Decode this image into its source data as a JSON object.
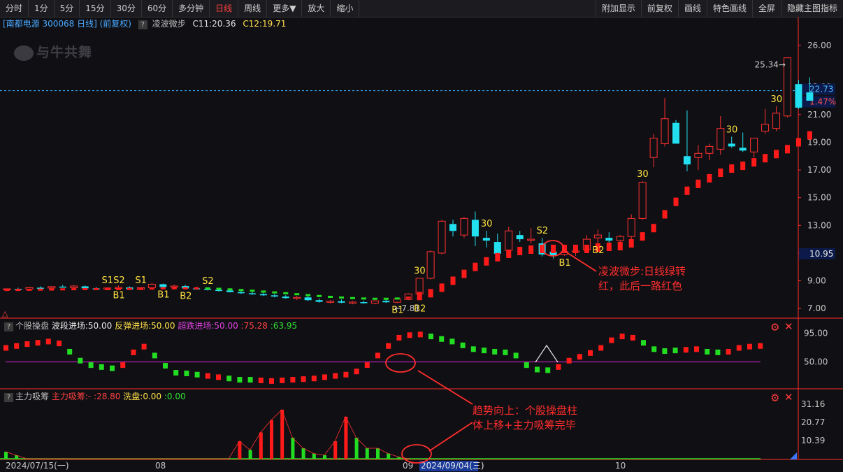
{
  "toolbar": {
    "left": [
      "分时",
      "1分",
      "5分",
      "15分",
      "30分",
      "60分",
      "多分钟",
      "日线",
      "周线",
      "更多▼",
      "放大",
      "缩小"
    ],
    "active_index": 7,
    "right": [
      "附加显示",
      "前复权",
      "画线",
      "特色画线",
      "全屏",
      "隐藏主图指标"
    ]
  },
  "infobar": {
    "stock": "[南都电源 300068 日线] (前复权)",
    "indicator": "凌波微步",
    "c1": "C11:20.36",
    "c2": "C12:19.71"
  },
  "logo": "与牛共舞",
  "panel2": {
    "name": "个股操盘",
    "s1": "波段进场:50.00",
    "s2": "反弹进场:50.00",
    "s3": "超跌进场:50.00",
    "s4": ":75.28",
    "s5": ":63.95",
    "yticks": [
      "95.00",
      "50.00"
    ]
  },
  "panel3": {
    "name": "主力吸筹",
    "s1": "主力吸筹:-",
    "s2": ":28.80",
    "s3": "洗盘:0.00",
    "s4": ":0.00",
    "yticks": [
      "31.16",
      "20.77",
      "10.39"
    ]
  },
  "colors": {
    "up": "#ff3030",
    "down": "#22e0f0",
    "ma": "#ff1a1a",
    "ma_green": "#22dd22",
    "signal": "#ffe040",
    "annot": "#ff2d2d",
    "axis": "#ff2d2d",
    "magenta": "#c020c0"
  },
  "chart_data": {
    "type": "candlestick",
    "ylim": [
      6.3,
      27.0
    ],
    "yticks": [
      "26.00",
      "23.00",
      "21.00",
      "19.00",
      "17.00",
      "15.00",
      "13.00",
      "11.00",
      "9.00",
      "7.00"
    ],
    "price_label": "22.73",
    "pct_label": "1.47%",
    "cross_label": "10.95",
    "high_label": "25.34",
    "low_label": "7.81",
    "x_labels": [
      "2024/07/15(一)",
      "08",
      "09",
      "2024/09/04(三)",
      "10"
    ],
    "candles": [
      [
        8.4,
        8.45,
        8.35,
        8.42
      ],
      [
        8.42,
        8.5,
        8.36,
        8.4
      ],
      [
        8.4,
        8.55,
        8.38,
        8.5
      ],
      [
        8.5,
        8.6,
        8.45,
        8.48
      ],
      [
        8.48,
        8.62,
        8.44,
        8.58
      ],
      [
        8.58,
        8.7,
        8.5,
        8.52
      ],
      [
        8.5,
        8.7,
        8.46,
        8.62
      ],
      [
        8.6,
        8.66,
        8.4,
        8.45
      ],
      [
        8.45,
        8.55,
        8.36,
        8.4
      ],
      [
        8.4,
        8.52,
        8.34,
        8.48
      ],
      [
        8.48,
        8.66,
        8.44,
        8.52
      ],
      [
        8.52,
        8.6,
        8.35,
        8.38
      ],
      [
        8.38,
        8.52,
        8.32,
        8.5
      ],
      [
        8.5,
        8.85,
        8.46,
        8.75
      ],
      [
        8.75,
        8.8,
        8.5,
        8.55
      ],
      [
        8.55,
        8.72,
        8.48,
        8.62
      ],
      [
        8.62,
        8.7,
        8.4,
        8.45
      ],
      [
        8.45,
        8.55,
        8.36,
        8.42
      ],
      [
        8.42,
        8.48,
        8.3,
        8.34
      ],
      [
        8.34,
        8.44,
        8.22,
        8.3
      ],
      [
        8.3,
        8.4,
        8.16,
        8.18
      ],
      [
        8.18,
        8.28,
        8.05,
        8.1
      ],
      [
        8.1,
        8.2,
        7.98,
        8.04
      ],
      [
        8.04,
        8.16,
        7.9,
        7.95
      ],
      [
        7.95,
        8.05,
        7.8,
        7.86
      ],
      [
        7.86,
        7.96,
        7.7,
        7.75
      ],
      [
        7.75,
        7.9,
        7.62,
        7.8
      ],
      [
        7.8,
        7.92,
        7.54,
        7.6
      ],
      [
        7.6,
        7.72,
        7.42,
        7.48
      ],
      [
        7.48,
        7.6,
        7.36,
        7.52
      ],
      [
        7.52,
        7.66,
        7.38,
        7.42
      ],
      [
        7.42,
        7.54,
        7.3,
        7.46
      ],
      [
        7.46,
        7.56,
        7.34,
        7.38
      ],
      [
        7.38,
        7.6,
        7.3,
        7.55
      ],
      [
        7.55,
        7.66,
        7.4,
        7.45
      ],
      [
        7.45,
        7.72,
        7.38,
        7.68
      ],
      [
        7.65,
        8.1,
        7.6,
        8.05
      ],
      [
        8.05,
        9.2,
        8.0,
        9.18
      ],
      [
        9.18,
        11.2,
        9.1,
        11.1
      ],
      [
        11.0,
        13.4,
        10.9,
        13.3
      ],
      [
        13.1,
        13.4,
        12.2,
        12.6
      ],
      [
        12.3,
        13.6,
        12.1,
        13.5
      ],
      [
        13.4,
        14.0,
        11.5,
        12.2
      ],
      [
        12.1,
        12.6,
        11.4,
        11.9
      ],
      [
        11.8,
        12.4,
        10.7,
        10.95
      ],
      [
        11.2,
        12.9,
        11.1,
        12.6
      ],
      [
        12.3,
        12.6,
        11.8,
        12.0
      ],
      [
        12.0,
        12.8,
        11.7,
        12.0
      ],
      [
        11.7,
        12.1,
        10.75,
        10.9
      ],
      [
        11.1,
        11.5,
        10.6,
        10.8
      ],
      [
        10.9,
        11.2,
        10.8,
        11.1
      ],
      [
        11.1,
        11.3,
        10.8,
        11.15
      ],
      [
        11.25,
        12.3,
        11.2,
        12.0
      ],
      [
        12.1,
        12.7,
        11.7,
        12.3
      ],
      [
        12.1,
        12.5,
        11.6,
        11.9
      ],
      [
        11.9,
        12.3,
        11.6,
        12.2
      ],
      [
        12.2,
        13.8,
        11.9,
        13.5
      ],
      [
        13.5,
        16.2,
        13.4,
        16.1
      ],
      [
        17.9,
        19.6,
        17.2,
        19.3
      ],
      [
        18.9,
        22.2,
        18.7,
        20.7
      ],
      [
        20.4,
        20.6,
        18.9,
        18.9
      ],
      [
        18.0,
        21.3,
        16.9,
        17.4
      ],
      [
        17.9,
        18.8,
        17.0,
        18.2
      ],
      [
        18.2,
        18.9,
        17.7,
        18.7
      ],
      [
        18.5,
        20.9,
        18.1,
        20.0
      ],
      [
        18.9,
        19.4,
        18.6,
        18.7
      ],
      [
        18.6,
        19.7,
        18.3,
        18.4
      ],
      [
        18.3,
        19.3,
        17.9,
        19.3
      ],
      [
        19.8,
        21.4,
        19.6,
        20.3
      ],
      [
        20.0,
        21.6,
        19.8,
        21.1
      ],
      [
        20.9,
        24.5,
        20.8,
        25.1
      ],
      [
        23.2,
        23.5,
        21.4,
        21.5
      ],
      [
        22.6,
        23.7,
        22.2,
        22.0
      ]
    ],
    "ma": [
      8.34,
      8.34,
      8.35,
      8.36,
      8.37,
      8.38,
      8.39,
      8.4,
      8.4,
      8.4,
      8.4,
      8.41,
      8.42,
      8.44,
      8.46,
      8.46,
      8.46,
      8.46,
      8.45,
      8.42,
      8.38,
      8.33,
      8.28,
      8.22,
      8.16,
      8.1,
      8.03,
      7.96,
      7.9,
      7.84,
      7.79,
      7.75,
      7.72,
      7.7,
      7.7,
      7.72,
      7.78,
      7.9,
      8.1,
      8.5,
      9.0,
      9.5,
      10.0,
      10.4,
      10.7,
      10.95,
      11.15,
      11.25,
      11.3,
      11.3,
      11.3,
      11.3,
      11.3,
      11.4,
      11.45,
      11.5,
      11.7,
      12.2,
      12.8,
      13.8,
      14.7,
      15.5,
      16.0,
      16.4,
      16.8,
      17.1,
      17.3,
      17.55,
      17.85,
      18.15,
      18.5,
      19.0,
      19.5
    ],
    "ma_colors": [
      "red",
      "red",
      "red",
      "red",
      "red",
      "red",
      "red",
      "red",
      "red",
      "red",
      "red",
      "red",
      "red",
      "red",
      "red",
      "red",
      "red",
      "red",
      "green",
      "green",
      "green",
      "green",
      "green",
      "green",
      "green",
      "green",
      "green",
      "green",
      "green",
      "green",
      "green",
      "green",
      "green",
      "green",
      "green",
      "green",
      "red",
      "red",
      "red",
      "red",
      "red",
      "red",
      "red",
      "red",
      "red",
      "red",
      "red",
      "red",
      "red",
      "red",
      "red",
      "red",
      "red",
      "red",
      "red",
      "red",
      "red",
      "red",
      "red",
      "red",
      "red",
      "red",
      "red",
      "red",
      "red",
      "red",
      "red",
      "red",
      "red",
      "red",
      "red",
      "red",
      "red"
    ],
    "signals": [
      {
        "i": 9,
        "text": "S1S2",
        "pos": "above"
      },
      {
        "i": 10,
        "text": "B1",
        "pos": "below"
      },
      {
        "i": 12,
        "text": "S1",
        "pos": "above"
      },
      {
        "i": 14,
        "text": "B1",
        "pos": "below"
      },
      {
        "i": 16,
        "text": "B2",
        "pos": "below"
      },
      {
        "i": 18,
        "text": "S2",
        "pos": "above"
      },
      {
        "i": 37,
        "text": "30",
        "pos": "above"
      },
      {
        "i": 37,
        "text": "B2",
        "pos": "below2"
      },
      {
        "i": 35,
        "text": "B1",
        "pos": "below"
      },
      {
        "i": 43,
        "text": "30",
        "pos": "above"
      },
      {
        "i": 48,
        "text": "S2",
        "pos": "above"
      },
      {
        "i": 50,
        "text": "B1",
        "pos": "below"
      },
      {
        "i": 53,
        "text": "B2",
        "pos": "below"
      },
      {
        "i": 57,
        "text": "30",
        "pos": "above"
      },
      {
        "i": 65,
        "text": "30",
        "pos": "above"
      },
      {
        "i": 69,
        "text": "30",
        "pos": "above"
      }
    ],
    "osc": [
      {
        "v": 72,
        "c": "red"
      },
      {
        "v": 75,
        "c": "red"
      },
      {
        "v": 78,
        "c": "red"
      },
      {
        "v": 80,
        "c": "red"
      },
      {
        "v": 82,
        "c": "red"
      },
      {
        "v": 79,
        "c": "red"
      },
      {
        "v": 66,
        "c": "green"
      },
      {
        "v": 52,
        "c": "green"
      },
      {
        "v": 45,
        "c": "green"
      },
      {
        "v": 42,
        "c": "green"
      },
      {
        "v": 40,
        "c": "green"
      },
      {
        "v": 45,
        "c": "red"
      },
      {
        "v": 65,
        "c": "red"
      },
      {
        "v": 74,
        "c": "red"
      },
      {
        "v": 60,
        "c": "green"
      },
      {
        "v": 44,
        "c": "green"
      },
      {
        "v": 33,
        "c": "green"
      },
      {
        "v": 32,
        "c": "green"
      },
      {
        "v": 30,
        "c": "green"
      },
      {
        "v": 28,
        "c": "red"
      },
      {
        "v": 26,
        "c": "red"
      },
      {
        "v": 24,
        "c": "green"
      },
      {
        "v": 22,
        "c": "green"
      },
      {
        "v": 22,
        "c": "green"
      },
      {
        "v": 21,
        "c": "red"
      },
      {
        "v": 20,
        "c": "red"
      },
      {
        "v": 21,
        "c": "red"
      },
      {
        "v": 22,
        "c": "red"
      },
      {
        "v": 23,
        "c": "red"
      },
      {
        "v": 24,
        "c": "red"
      },
      {
        "v": 26,
        "c": "red"
      },
      {
        "v": 28,
        "c": "red"
      },
      {
        "v": 30,
        "c": "red"
      },
      {
        "v": 35,
        "c": "red"
      },
      {
        "v": 45,
        "c": "red"
      },
      {
        "v": 60,
        "c": "red"
      },
      {
        "v": 75,
        "c": "red"
      },
      {
        "v": 88,
        "c": "red"
      },
      {
        "v": 92,
        "c": "red"
      },
      {
        "v": 93,
        "c": "red"
      },
      {
        "v": 90,
        "c": "green"
      },
      {
        "v": 86,
        "c": "green"
      },
      {
        "v": 82,
        "c": "green"
      },
      {
        "v": 76,
        "c": "green"
      },
      {
        "v": 70,
        "c": "green"
      },
      {
        "v": 68,
        "c": "green"
      },
      {
        "v": 66,
        "c": "green"
      },
      {
        "v": 65,
        "c": "green"
      },
      {
        "v": 60,
        "c": "green"
      },
      {
        "v": 45,
        "c": "green"
      },
      {
        "v": 38,
        "c": "green"
      },
      {
        "v": 37,
        "c": "green"
      },
      {
        "v": 42,
        "c": "red"
      },
      {
        "v": 52,
        "c": "red"
      },
      {
        "v": 58,
        "c": "red"
      },
      {
        "v": 64,
        "c": "red"
      },
      {
        "v": 72,
        "c": "red"
      },
      {
        "v": 84,
        "c": "red"
      },
      {
        "v": 90,
        "c": "red"
      },
      {
        "v": 88,
        "c": "red"
      },
      {
        "v": 80,
        "c": "green"
      },
      {
        "v": 70,
        "c": "green"
      },
      {
        "v": 67,
        "c": "green"
      },
      {
        "v": 68,
        "c": "green"
      },
      {
        "v": 69,
        "c": "red"
      },
      {
        "v": 70,
        "c": "red"
      },
      {
        "v": 66,
        "c": "green"
      },
      {
        "v": 65,
        "c": "green"
      },
      {
        "v": 66,
        "c": "red"
      },
      {
        "v": 72,
        "c": "red"
      },
      {
        "v": 74,
        "c": "red"
      },
      {
        "v": 75,
        "c": "red"
      }
    ],
    "accum": [
      {
        "v": 4,
        "c": "green"
      },
      {
        "v": 2,
        "c": "green"
      },
      {
        "v": 0,
        "c": "green"
      },
      {
        "v": 0,
        "c": "green"
      },
      {
        "v": 0,
        "c": "green"
      },
      {
        "v": 0,
        "c": "green"
      },
      {
        "v": 0,
        "c": "green"
      },
      {
        "v": 0,
        "c": "green"
      },
      {
        "v": 0,
        "c": "green"
      },
      {
        "v": 0,
        "c": "green"
      },
      {
        "v": 0,
        "c": "green"
      },
      {
        "v": 0,
        "c": "green"
      },
      {
        "v": 0,
        "c": "green"
      },
      {
        "v": 0,
        "c": "green"
      },
      {
        "v": 0,
        "c": "green"
      },
      {
        "v": 0,
        "c": "green"
      },
      {
        "v": 0,
        "c": "green"
      },
      {
        "v": 0,
        "c": "green"
      },
      {
        "v": 0,
        "c": "green"
      },
      {
        "v": 0,
        "c": "green"
      },
      {
        "v": 0,
        "c": "green"
      },
      {
        "v": 0,
        "c": "green"
      },
      {
        "v": 10,
        "c": "red"
      },
      {
        "v": 5,
        "c": "green"
      },
      {
        "v": 15,
        "c": "red"
      },
      {
        "v": 22,
        "c": "red"
      },
      {
        "v": 28,
        "c": "red"
      },
      {
        "v": 12,
        "c": "green"
      },
      {
        "v": 6,
        "c": "green"
      },
      {
        "v": 3,
        "c": "green"
      },
      {
        "v": 2,
        "c": "green"
      },
      {
        "v": 10,
        "c": "red"
      },
      {
        "v": 24,
        "c": "red"
      },
      {
        "v": 12,
        "c": "green"
      },
      {
        "v": 6,
        "c": "green"
      },
      {
        "v": 6,
        "c": "green"
      },
      {
        "v": 3,
        "c": "green"
      },
      {
        "v": 1,
        "c": "green"
      },
      {
        "v": 0,
        "c": "green"
      }
    ]
  },
  "annotations": {
    "a1_line1": "凌波微步:日线绿转",
    "a1_line2": "红，此后一路红色",
    "a2_line1": "趋势向上：个股操盘柱",
    "a2_line2": "体上移+主力吸筹完毕"
  }
}
